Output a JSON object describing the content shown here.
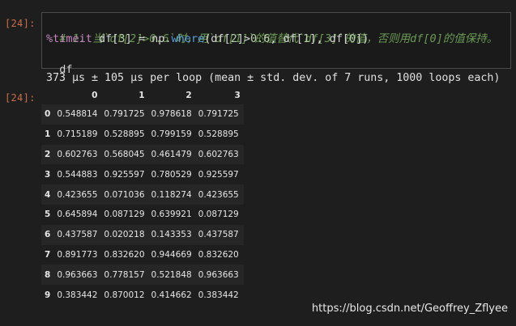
{
  "cell": {
    "in_prompt": "[24]:",
    "out_prompt": "[24]:",
    "code": {
      "line1_comment": "# 1. 当`df[2]>0.6`时，用`df[1]`的值替代`df[3]`的值，否则用df[0]的值保持。",
      "line2": {
        "magic": "%timeit",
        "t1": " df[",
        "n1": "3",
        "t2": "] = np.",
        "fn": "where",
        "t3": "(df[",
        "n2": "2",
        "t4": "]>",
        "n3": "0.6",
        "t5": ", df[",
        "n4": "1",
        "t6": "], df[",
        "n5": "0",
        "t7": "])"
      },
      "line3": "df"
    },
    "stdout": "373 µs ± 105 µs per loop (mean ± std. dev. of 7 runs, 1000 loops each)"
  },
  "dataframe": {
    "columns": [
      "",
      "0",
      "1",
      "2",
      "3"
    ],
    "rows": [
      [
        "0",
        "0.548814",
        "0.791725",
        "0.978618",
        "0.791725"
      ],
      [
        "1",
        "0.715189",
        "0.528895",
        "0.799159",
        "0.528895"
      ],
      [
        "2",
        "0.602763",
        "0.568045",
        "0.461479",
        "0.602763"
      ],
      [
        "3",
        "0.544883",
        "0.925597",
        "0.780529",
        "0.925597"
      ],
      [
        "4",
        "0.423655",
        "0.071036",
        "0.118274",
        "0.423655"
      ],
      [
        "5",
        "0.645894",
        "0.087129",
        "0.639921",
        "0.087129"
      ],
      [
        "6",
        "0.437587",
        "0.020218",
        "0.143353",
        "0.437587"
      ],
      [
        "7",
        "0.891773",
        "0.832620",
        "0.944669",
        "0.832620"
      ],
      [
        "8",
        "0.963663",
        "0.778157",
        "0.521848",
        "0.963663"
      ],
      [
        "9",
        "0.383442",
        "0.870012",
        "0.414662",
        "0.383442"
      ]
    ]
  },
  "watermark": "https://blog.csdn.net/Geoffrey_Zflyee"
}
